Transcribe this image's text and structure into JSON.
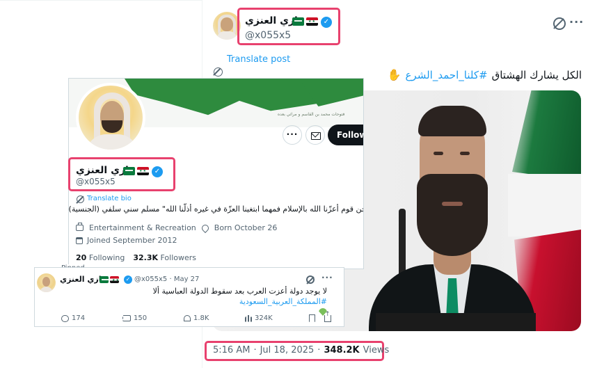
{
  "post": {
    "author_name": "غازي العنزي",
    "author_handle": "@x055x5",
    "translate_label": "Translate post",
    "text_prefix": "الكل يشارك الهشتاق",
    "hashtag": "#كلنا_احمد_الشرع",
    "hand_emoji": "✋",
    "time": "5:16 AM",
    "separator": "·",
    "date": "Jul 18, 2025",
    "views_count": "348.2K",
    "views_label": "Views"
  },
  "profile_card": {
    "name": "غازي العنزي",
    "handle": "@x055x5",
    "more_label": "···",
    "follow_label": "Follow",
    "translate_bio_label": "Translate bio",
    "bio": "نحن قوم أعزّنا الله بالإسلام فمهما ابتغينا العزّة في غيره أذلّنا الله\" مسلم سني سلفي (الجنسية)",
    "category": "Entertainment & Recreation",
    "born": "Born October 26",
    "joined": "Joined September 2012",
    "following_count": "20",
    "following_label": "Following",
    "followers_count": "32.3K",
    "followers_label": "Followers",
    "banner_caption": "فتوحات محمد بن القاسم و مراثي بعده"
  },
  "pinned_tweet": {
    "pinned_label": "Pinned",
    "name": "غازي العنزي",
    "handle_date": "@x055x5 · May 27",
    "text": "لا يوجد دولة أعزت العرب بعد سقوط الدولة العباسية ألا",
    "hashtag": "#المملكة_العربية_السعودية",
    "replies": "174",
    "reposts": "150",
    "likes": "1.8K",
    "views": "324K"
  },
  "icons": {
    "verified": "verified-badge-icon",
    "grok": "grok-icon",
    "more": "more-icon",
    "translate": "translate-icon"
  },
  "colors": {
    "highlight": "#e8416e",
    "link": "#1d9bf0",
    "verified": "#1d9bf0",
    "muted": "#536471"
  }
}
